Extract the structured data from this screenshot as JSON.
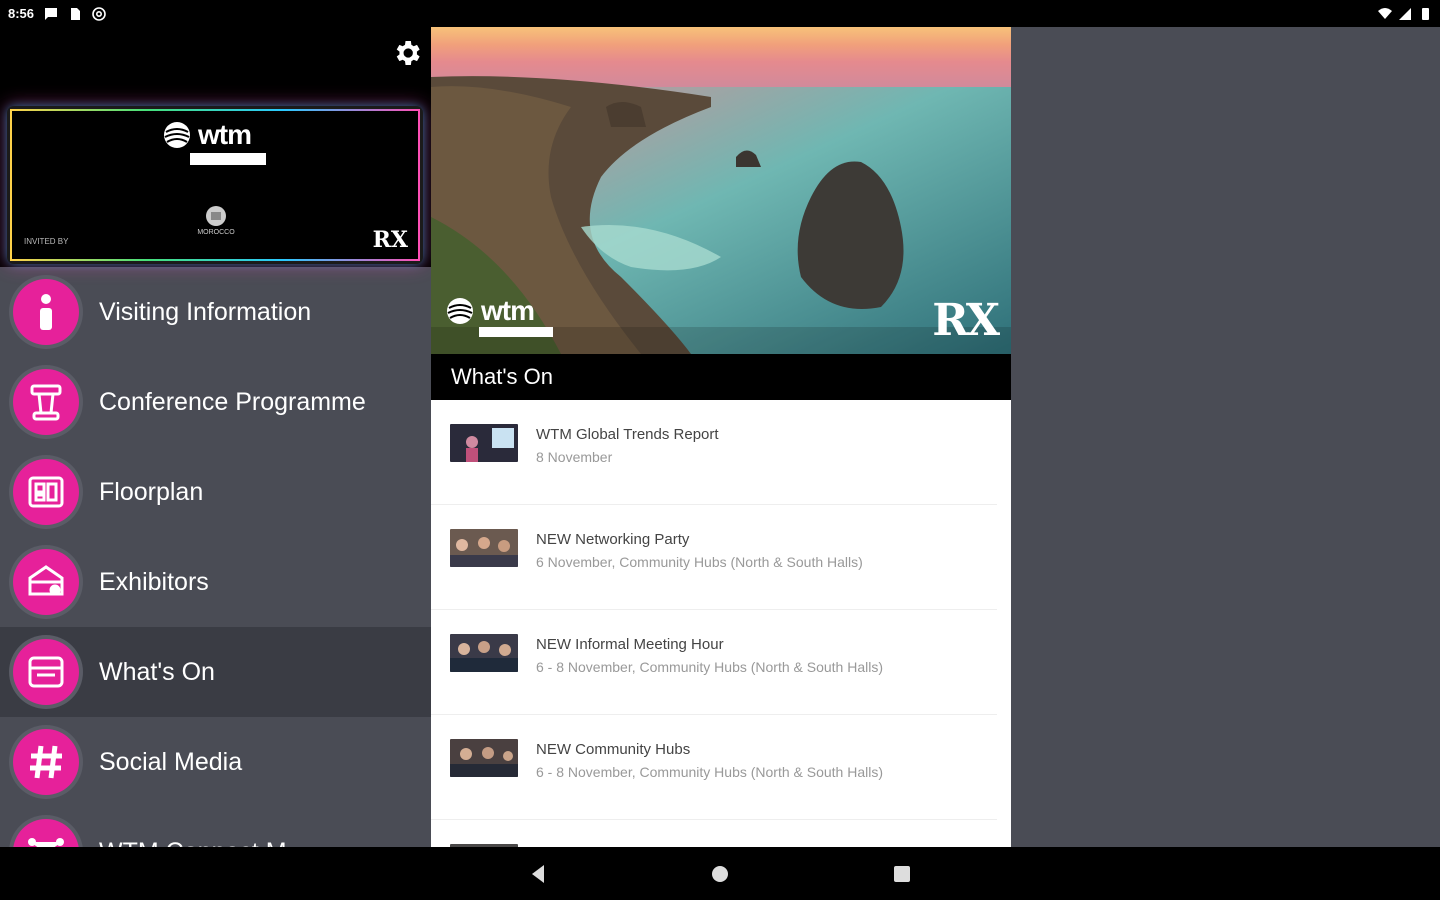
{
  "status_bar": {
    "time": "8:56",
    "left_icons": [
      "message-icon",
      "sim-icon",
      "at-icon"
    ],
    "right_icons": [
      "wifi-icon",
      "signal-icon",
      "battery-icon"
    ]
  },
  "sidebar": {
    "banner": {
      "logo_text": "wtm",
      "left_small_text": "INVITED BY",
      "partner_label": "MOROCCO",
      "rx_text": "RX"
    },
    "items": [
      {
        "label": "Visiting Information",
        "icon": "info-icon",
        "active": false
      },
      {
        "label": "Conference Programme",
        "icon": "podium-icon",
        "active": false
      },
      {
        "label": "Floorplan",
        "icon": "floorplan-icon",
        "active": false
      },
      {
        "label": "Exhibitors",
        "icon": "exhibitor-icon",
        "active": false
      },
      {
        "label": "What's On",
        "icon": "calendar-icon",
        "active": true
      },
      {
        "label": "Social Media",
        "icon": "hashtag-icon",
        "active": false
      },
      {
        "label": "WTM Connect M...",
        "icon": "network-icon",
        "active": false
      }
    ]
  },
  "main": {
    "hero": {
      "logo_text": "wtm",
      "rx_text": "RX"
    },
    "section_title": "What's On",
    "events": [
      {
        "title": "WTM Global Trends Report",
        "date": "8 November"
      },
      {
        "title": "NEW Networking Party",
        "date": "6 November, Community Hubs (North & South Halls)"
      },
      {
        "title": "NEW Informal Meeting Hour",
        "date": "6 - 8 November, Community Hubs (North & South Halls)"
      },
      {
        "title": "NEW Community Hubs",
        "date": "6 - 8 November, Community Hubs (North & South Halls)"
      }
    ]
  },
  "colors": {
    "accent": "#e6219a",
    "sidebar_bg": "#4a4c55",
    "active_bg": "#3a3c44"
  }
}
